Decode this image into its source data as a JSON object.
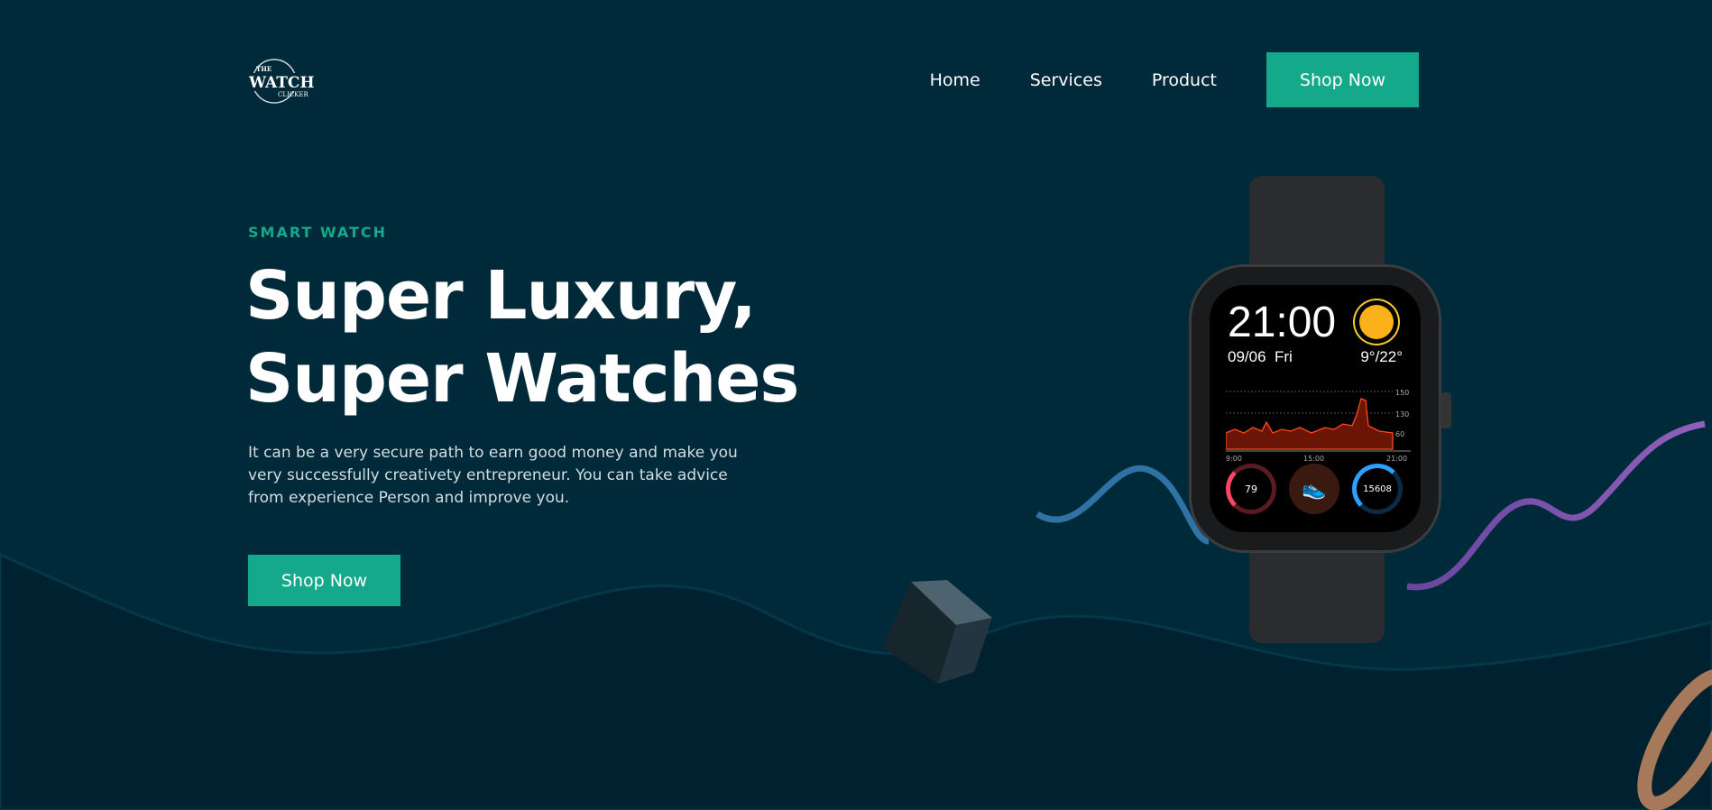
{
  "logo": {
    "text_top": "THE",
    "text_main": "WATCH",
    "text_bottom": "CLICKER"
  },
  "nav": {
    "items": [
      "Home",
      "Services",
      "Product"
    ],
    "cta": "Shop Now"
  },
  "hero": {
    "eyebrow": "SMART WATCH",
    "title_line1": "Super Luxury,",
    "title_line2": "Super Watches",
    "description": "It can be a very secure path to earn good money and make you very successfully creativety entrepreneur. You can take advice from experience Person and improve you.",
    "cta": "Shop Now"
  },
  "watch": {
    "time": "21:00",
    "date": "09/06  Fri",
    "temp": "9°/22°",
    "y_labels": [
      "150",
      "130",
      "60"
    ],
    "x_labels": [
      "9:00",
      "15:00",
      "21:00"
    ],
    "heart_rate": "79",
    "steps": "15608"
  },
  "colors": {
    "background": "#002a3a",
    "accent": "#14a98b"
  }
}
